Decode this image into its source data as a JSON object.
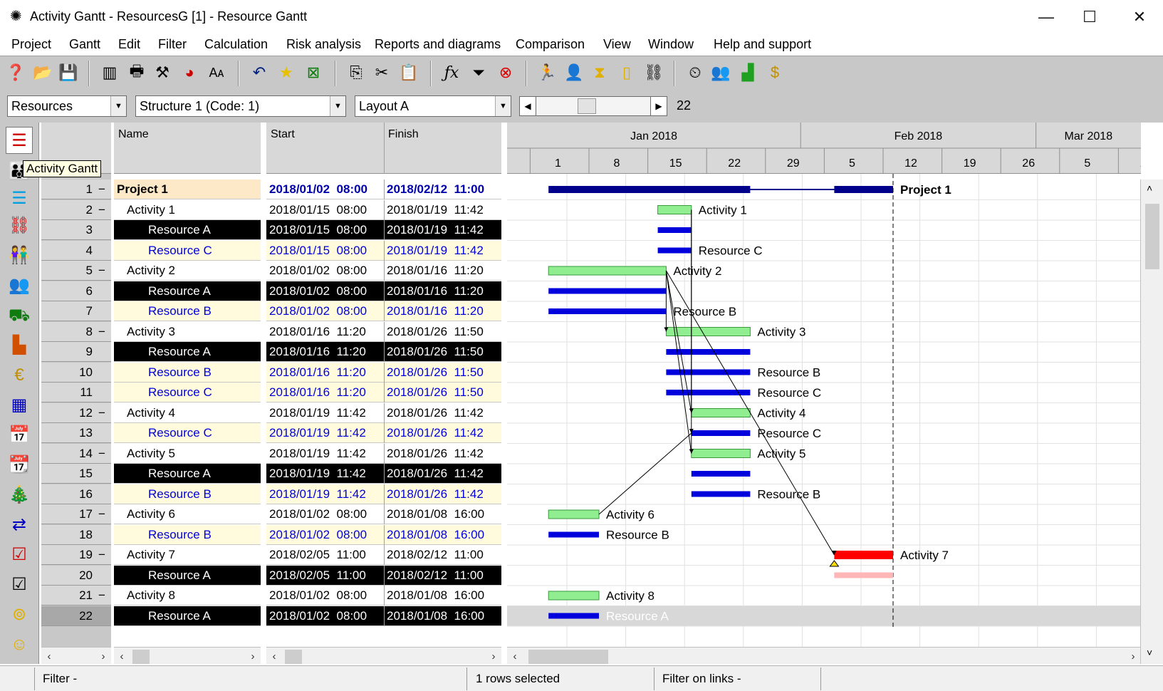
{
  "window": {
    "title": "Activity Gantt - ResourcesG [1] - Resource Gantt",
    "minimize": "—",
    "maximize": "☐",
    "close": "✕"
  },
  "menu": [
    "Project",
    "Gantt",
    "Edit",
    "Filter",
    "Calculation",
    "Risk analysis",
    "Reports and diagrams",
    "Comparison",
    "View",
    "Window",
    "Help and support"
  ],
  "combos": {
    "view": "Resources",
    "structure": "Structure 1 (Code: 1)",
    "layout": "Layout A",
    "zoom_value": "22"
  },
  "tooltip": "Activity Gantt",
  "columns": {
    "name": "Name",
    "start": "Start",
    "finish": "Finish"
  },
  "timeline": {
    "months": [
      "Jan 2018",
      "Feb 2018",
      "Mar 2018"
    ],
    "days": [
      "1",
      "8",
      "15",
      "22",
      "29",
      "5",
      "12",
      "19",
      "26",
      "5",
      "12"
    ]
  },
  "rows": [
    {
      "num": "1",
      "toggle": "−",
      "name": "Project 1",
      "start": "2018/01/02  08:00",
      "finish": "2018/02/12  11:00",
      "kind": "project"
    },
    {
      "num": "2",
      "toggle": "−",
      "name": "Activity 1",
      "start": "2018/01/15  08:00",
      "finish": "2018/01/19  11:42",
      "kind": "activity"
    },
    {
      "num": "3",
      "toggle": "",
      "name": "Resource A",
      "start": "2018/01/15  08:00",
      "finish": "2018/01/19  11:42",
      "kind": "resA"
    },
    {
      "num": "4",
      "toggle": "",
      "name": "Resource C",
      "start": "2018/01/15  08:00",
      "finish": "2018/01/19  11:42",
      "kind": "res"
    },
    {
      "num": "5",
      "toggle": "−",
      "name": "Activity 2",
      "start": "2018/01/02  08:00",
      "finish": "2018/01/16  11:20",
      "kind": "activity"
    },
    {
      "num": "6",
      "toggle": "",
      "name": "Resource A",
      "start": "2018/01/02  08:00",
      "finish": "2018/01/16  11:20",
      "kind": "resA"
    },
    {
      "num": "7",
      "toggle": "",
      "name": "Resource B",
      "start": "2018/01/02  08:00",
      "finish": "2018/01/16  11:20",
      "kind": "res"
    },
    {
      "num": "8",
      "toggle": "−",
      "name": "Activity 3",
      "start": "2018/01/16  11:20",
      "finish": "2018/01/26  11:50",
      "kind": "activity"
    },
    {
      "num": "9",
      "toggle": "",
      "name": "Resource A",
      "start": "2018/01/16  11:20",
      "finish": "2018/01/26  11:50",
      "kind": "resA"
    },
    {
      "num": "10",
      "toggle": "",
      "name": "Resource B",
      "start": "2018/01/16  11:20",
      "finish": "2018/01/26  11:50",
      "kind": "res"
    },
    {
      "num": "11",
      "toggle": "",
      "name": "Resource C",
      "start": "2018/01/16  11:20",
      "finish": "2018/01/26  11:50",
      "kind": "res"
    },
    {
      "num": "12",
      "toggle": "−",
      "name": "Activity 4",
      "start": "2018/01/19  11:42",
      "finish": "2018/01/26  11:42",
      "kind": "activity"
    },
    {
      "num": "13",
      "toggle": "",
      "name": "Resource C",
      "start": "2018/01/19  11:42",
      "finish": "2018/01/26  11:42",
      "kind": "res"
    },
    {
      "num": "14",
      "toggle": "−",
      "name": "Activity 5",
      "start": "2018/01/19  11:42",
      "finish": "2018/01/26  11:42",
      "kind": "activity"
    },
    {
      "num": "15",
      "toggle": "",
      "name": "Resource A",
      "start": "2018/01/19  11:42",
      "finish": "2018/01/26  11:42",
      "kind": "resA"
    },
    {
      "num": "16",
      "toggle": "",
      "name": "Resource B",
      "start": "2018/01/19  11:42",
      "finish": "2018/01/26  11:42",
      "kind": "res"
    },
    {
      "num": "17",
      "toggle": "−",
      "name": "Activity 6",
      "start": "2018/01/02  08:00",
      "finish": "2018/01/08  16:00",
      "kind": "activity"
    },
    {
      "num": "18",
      "toggle": "",
      "name": "Resource B",
      "start": "2018/01/02  08:00",
      "finish": "2018/01/08  16:00",
      "kind": "res"
    },
    {
      "num": "19",
      "toggle": "−",
      "name": "Activity 7",
      "start": "2018/02/05  11:00",
      "finish": "2018/02/12  11:00",
      "kind": "activity"
    },
    {
      "num": "20",
      "toggle": "",
      "name": "Resource A",
      "start": "2018/02/05  11:00",
      "finish": "2018/02/12  11:00",
      "kind": "resA"
    },
    {
      "num": "21",
      "toggle": "−",
      "name": "Activity 8",
      "start": "2018/01/02  08:00",
      "finish": "2018/01/08  16:00",
      "kind": "activity"
    },
    {
      "num": "22",
      "toggle": "",
      "name": "Resource A",
      "start": "2018/01/02  08:00",
      "finish": "2018/01/08  16:00",
      "kind": "resA"
    }
  ],
  "bars": [
    {
      "label": "Project 1",
      "start": "2018-01-02",
      "end": "2018-02-12",
      "type": "project"
    },
    {
      "label": "Activity 1",
      "start": "2018-01-15",
      "end": "2018-01-19",
      "type": "activity"
    },
    {
      "label": "",
      "start": "2018-01-15",
      "end": "2018-01-19",
      "type": "resource"
    },
    {
      "label": "Resource C",
      "start": "2018-01-15",
      "end": "2018-01-19",
      "type": "resource"
    },
    {
      "label": "Activity 2",
      "start": "2018-01-02",
      "end": "2018-01-16",
      "type": "activity"
    },
    {
      "label": "",
      "start": "2018-01-02",
      "end": "2018-01-16",
      "type": "resource"
    },
    {
      "label": "Resource B",
      "start": "2018-01-02",
      "end": "2018-01-16",
      "type": "resource"
    },
    {
      "label": "Activity 3",
      "start": "2018-01-16",
      "end": "2018-01-26",
      "type": "activity"
    },
    {
      "label": "",
      "start": "2018-01-16",
      "end": "2018-01-26",
      "type": "resource"
    },
    {
      "label": "Resource B",
      "start": "2018-01-16",
      "end": "2018-01-26",
      "type": "resource"
    },
    {
      "label": "Resource C",
      "start": "2018-01-16",
      "end": "2018-01-26",
      "type": "resource"
    },
    {
      "label": "Activity 4",
      "start": "2018-01-19",
      "end": "2018-01-26",
      "type": "activity"
    },
    {
      "label": "Resource C",
      "start": "2018-01-19",
      "end": "2018-01-26",
      "type": "resource"
    },
    {
      "label": "Activity 5",
      "start": "2018-01-19",
      "end": "2018-01-26",
      "type": "activity"
    },
    {
      "label": "",
      "start": "2018-01-19",
      "end": "2018-01-26",
      "type": "resource"
    },
    {
      "label": "Resource B",
      "start": "2018-01-19",
      "end": "2018-01-26",
      "type": "resource"
    },
    {
      "label": "Activity 6",
      "start": "2018-01-02",
      "end": "2018-01-08",
      "type": "activity"
    },
    {
      "label": "Resource B",
      "start": "2018-01-02",
      "end": "2018-01-08",
      "type": "resource"
    },
    {
      "label": "Activity 7",
      "start": "2018-02-05",
      "end": "2018-02-12",
      "type": "critical"
    },
    {
      "label": "",
      "start": "2018-02-05",
      "end": "2018-02-12",
      "type": "critical-resource"
    },
    {
      "label": "Activity 8",
      "start": "2018-01-02",
      "end": "2018-01-08",
      "type": "activity"
    },
    {
      "label": "Resource A",
      "start": "2018-01-02",
      "end": "2018-01-08",
      "type": "resource"
    }
  ],
  "status": {
    "filter": "Filter -",
    "selected": "1 rows selected",
    "link_filter": "Filter on links -"
  },
  "colors": {
    "activity": "#90ee90",
    "resource": "#0000dd",
    "project": "#00008b",
    "critical": "#ff0000",
    "critical_resource": "#ffb6b6",
    "resA_bg": "#000000",
    "res_bg": "#fffbdc"
  }
}
